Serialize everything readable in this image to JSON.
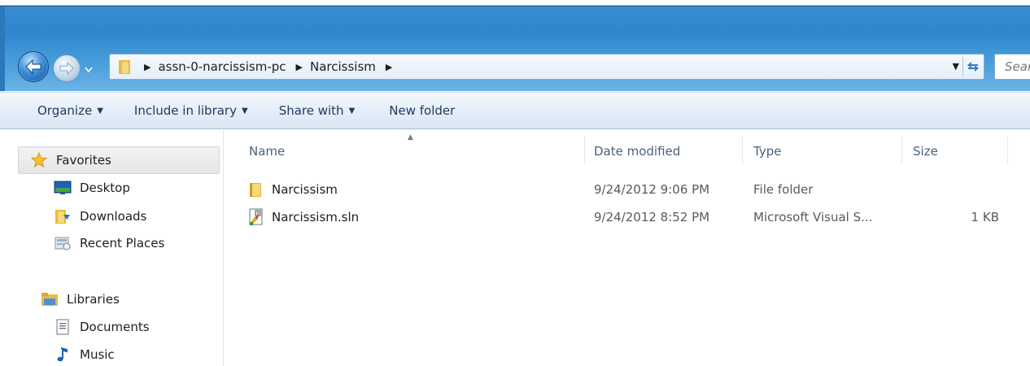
{
  "navigation": {
    "back_label": "Back",
    "forward_label": "Forward"
  },
  "address_bar": {
    "crumbs": [
      "assn-0-narcissism-pc",
      "Narcissism"
    ]
  },
  "search": {
    "placeholder": "Search Narcissism"
  },
  "toolbar": {
    "organize_label": "Organize",
    "include_label": "Include in library",
    "share_label": "Share with",
    "new_folder_label": "New folder"
  },
  "sidebar": {
    "favorites": {
      "header": "Favorites",
      "items": [
        "Desktop",
        "Downloads",
        "Recent Places"
      ]
    },
    "libraries": {
      "header": "Libraries",
      "items": [
        "Documents",
        "Music"
      ]
    }
  },
  "columns": {
    "name": "Name",
    "date": "Date modified",
    "type": "Type",
    "size": "Size"
  },
  "files": [
    {
      "name": "Narcissism",
      "date": "9/24/2012 9:06 PM",
      "type": "File folder",
      "size": "",
      "icon": "folder-icon"
    },
    {
      "name": "Narcissism.sln",
      "date": "9/24/2012 8:52 PM",
      "type": "Microsoft Visual S...",
      "size": "1 KB",
      "icon": "solution-file-icon"
    }
  ],
  "colors": {
    "aero_blue": "#2f86cd",
    "toolbar_text": "#1e3a5f",
    "header_text": "#4c607a",
    "folder_yellow": "#f1c84b"
  }
}
